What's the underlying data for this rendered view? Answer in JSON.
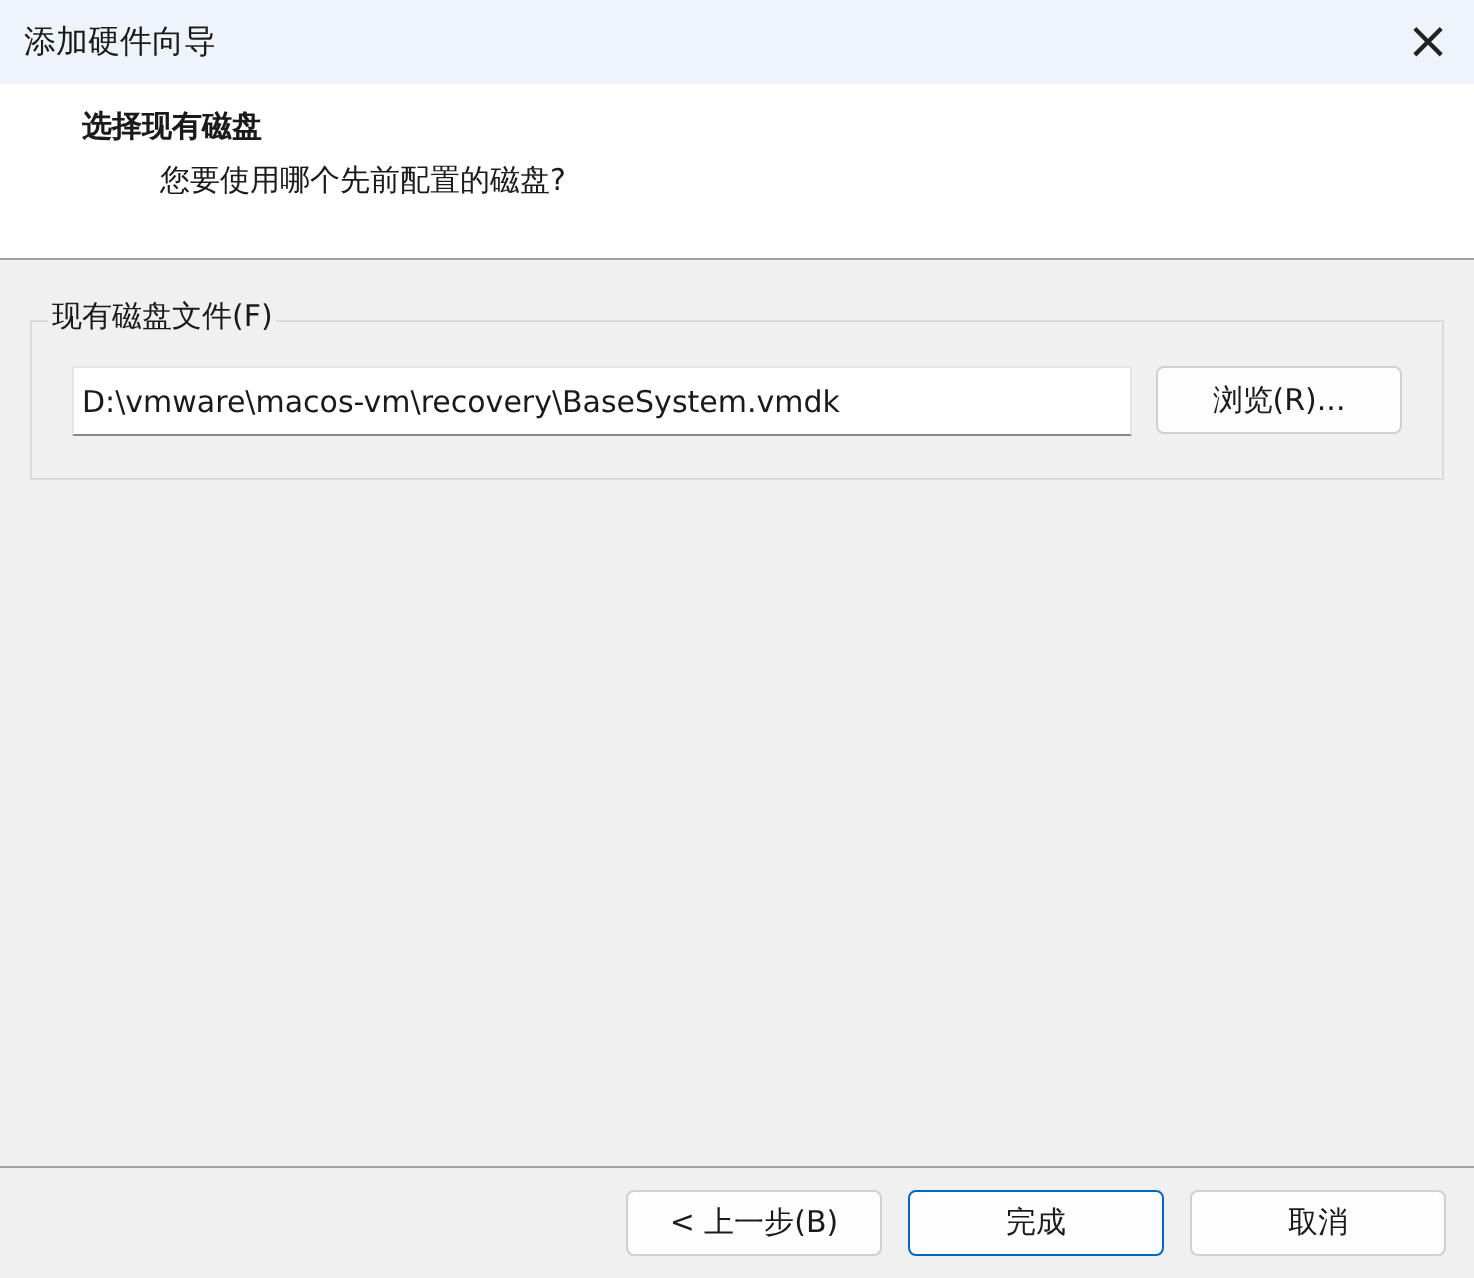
{
  "window": {
    "title": "添加硬件向导",
    "close": "×"
  },
  "header": {
    "title": "选择现有磁盘",
    "subtitle": "您要使用哪个先前配置的磁盘?"
  },
  "group": {
    "label": "现有磁盘文件(F)",
    "field": {
      "value": "D:\\vmware\\macos-vm\\recovery\\BaseSystem.vmdk"
    },
    "browse": "浏览(R)..."
  },
  "buttons": [
    {
      "label": "< 上一步(B)",
      "default": false
    },
    {
      "label": "完成",
      "default": true
    },
    {
      "label": "取消",
      "default": false
    }
  ]
}
